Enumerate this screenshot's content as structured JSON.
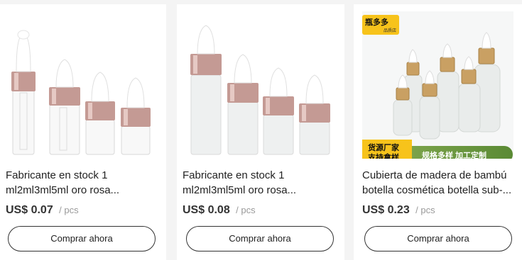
{
  "products": [
    {
      "title": "Fabricante en stock 1 ml2ml3ml5ml oro rosa...",
      "price": "US$ 0.07",
      "unit": "/ pcs",
      "button": "Comprar ahora",
      "image": "clear-glass-dropper-bottles-rose-gold-caps"
    },
    {
      "title": "Fabricante en stock 1 ml2ml3ml5ml oro rosa...",
      "price": "US$ 0.08",
      "unit": "/ pcs",
      "button": "Comprar ahora",
      "image": "frosted-glass-dropper-bottles-rose-gold-caps"
    },
    {
      "title": "Cubierta de madera de bambú botella cosmética botella sub-...",
      "price": "US$ 0.23",
      "unit": "/ pcs",
      "button": "Comprar ahora",
      "image": "frosted-bottles-bamboo-caps",
      "badge": {
        "name": "瓶多多",
        "sub": "品质店"
      },
      "promo": {
        "line1": "货源厂家",
        "line2": "支持拿样",
        "right": "规格多样  加工定制"
      }
    }
  ],
  "colors": {
    "rose_gold": "#c49a94",
    "badge_yellow": "#f7c31b",
    "promo_green": "#6a9a3e"
  }
}
